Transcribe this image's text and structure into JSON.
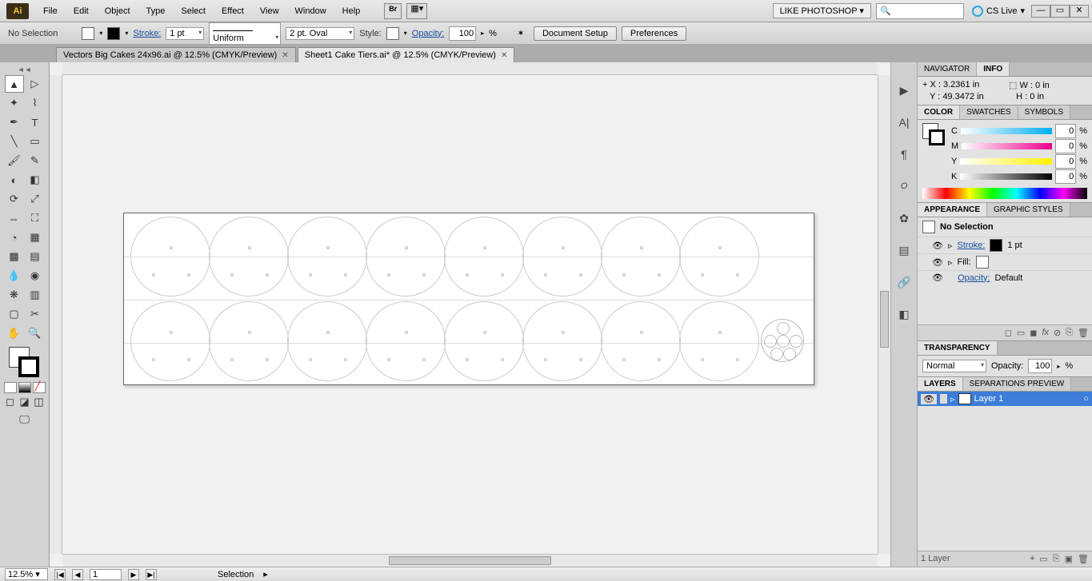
{
  "menubar": {
    "items": [
      "File",
      "Edit",
      "Object",
      "Type",
      "Select",
      "Effect",
      "View",
      "Window",
      "Help"
    ],
    "workspace": "LIKE PHOTOSHOP",
    "cslive": "CS Live",
    "search_placeholder": ""
  },
  "controlbar": {
    "selection": "No Selection",
    "stroke_label": "Stroke:",
    "stroke_weight": "1 pt",
    "brush": "Uniform",
    "variable": "2 pt. Oval",
    "style_label": "Style:",
    "opacity_label": "Opacity:",
    "opacity_value": "100",
    "opacity_pct": "%",
    "doc_setup": "Document Setup",
    "prefs": "Preferences"
  },
  "tabs": [
    {
      "label": "Vectors Big Cakes 24x96.ai @ 12.5% (CMYK/Preview)",
      "active": false
    },
    {
      "label": "Sheet1 Cake Tiers.ai* @ 12.5% (CMYK/Preview)",
      "active": true
    }
  ],
  "info": {
    "tab_nav": "NAVIGATOR",
    "tab_info": "INFO",
    "x_label": "X :",
    "x_val": "3.2361 in",
    "y_label": "Y :",
    "y_val": "49.3472 in",
    "w_label": "W :",
    "w_val": "0 in",
    "h_label": "H :",
    "h_val": "0 in"
  },
  "color": {
    "tab_color": "COLOR",
    "tab_swatches": "SWATCHES",
    "tab_symbols": "SYMBOLS",
    "c": "C",
    "m": "M",
    "y": "Y",
    "k": "K",
    "c_val": "0",
    "m_val": "0",
    "y_val": "0",
    "k_val": "0",
    "pct": "%"
  },
  "appearance": {
    "tab_app": "APPEARANCE",
    "tab_gs": "GRAPHIC STYLES",
    "title": "No Selection",
    "stroke_label": "Stroke:",
    "stroke_val": "1 pt",
    "fill_label": "Fill:",
    "opacity_label": "Opacity:",
    "opacity_val": "Default"
  },
  "transparency": {
    "tab": "TRANSPARENCY",
    "mode": "Normal",
    "opacity_label": "Opacity:",
    "opacity_val": "100",
    "pct": "%"
  },
  "layers": {
    "tab_layers": "LAYERS",
    "tab_sep": "SEPARATIONS PREVIEW",
    "layer_name": "Layer 1",
    "footer": "1 Layer"
  },
  "status": {
    "zoom": "12.5%",
    "page": "1",
    "tool": "Selection"
  }
}
